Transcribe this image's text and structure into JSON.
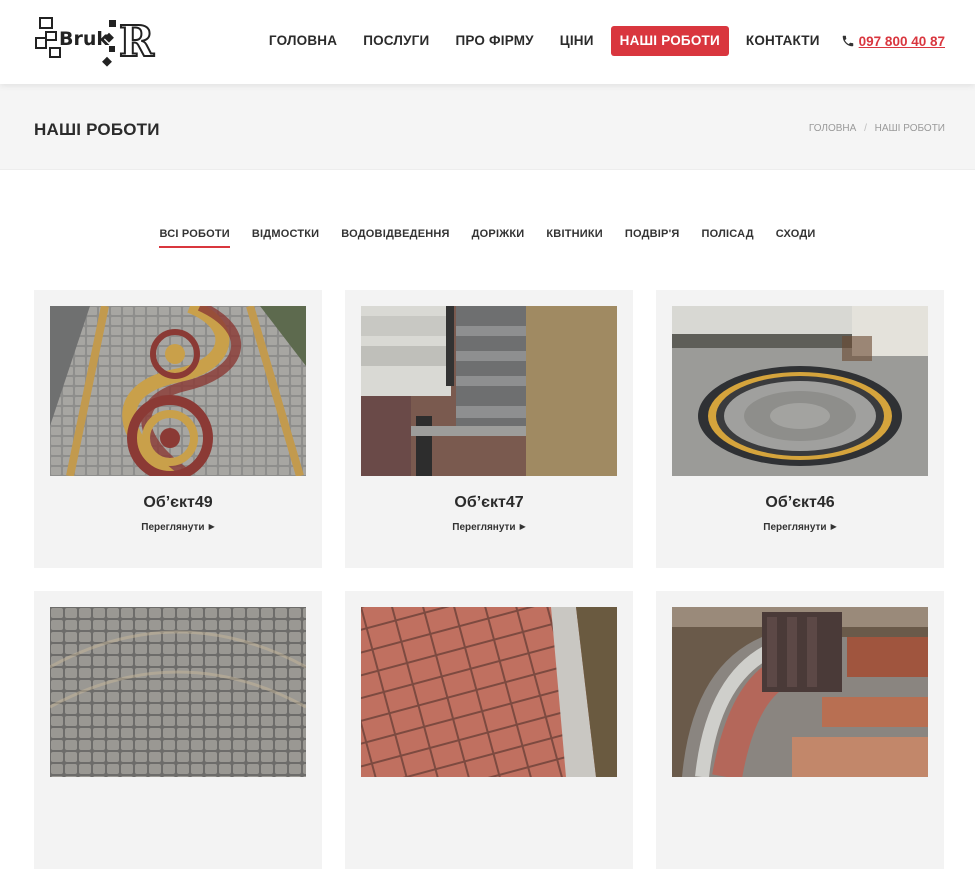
{
  "header": {
    "logo_text": "BrukR",
    "nav": [
      {
        "label": "ГОЛОВНА",
        "active": false
      },
      {
        "label": "ПОСЛУГИ",
        "active": false
      },
      {
        "label": "ПРО ФІРМУ",
        "active": false
      },
      {
        "label": "ЦІНИ",
        "active": false
      },
      {
        "label": "НАШІ РОБОТИ",
        "active": true
      },
      {
        "label": "КОНТАКТИ",
        "active": false
      }
    ],
    "phone": "097 800 40 87",
    "phone_icon": "phone-icon"
  },
  "title_bar": {
    "title": "НАШІ РОБОТИ",
    "breadcrumb": [
      "ГОЛОВНА",
      "НАШІ РОБОТИ"
    ]
  },
  "filters": [
    "ВСІ РОБОТИ",
    "ВІДМОСТКИ",
    "ВОДОВІДВЕДЕННЯ",
    "ДОРІЖКИ",
    "КВІТНИКИ",
    "ПОДВІР'Я",
    "ПОЛІСАД",
    "СХОДИ"
  ],
  "active_filter": "ВСІ РОБОТИ",
  "works": [
    {
      "title": "Об’єкт49",
      "link": "Переглянути",
      "image": "paving-wave-pattern"
    },
    {
      "title": "Об’єкт47",
      "link": "Переглянути",
      "image": "paving-steps-drain"
    },
    {
      "title": "Об’єкт46",
      "link": "Переглянути",
      "image": "paving-circle-pattern"
    },
    {
      "title": "",
      "link": "",
      "image": "cobblestone-arcs"
    },
    {
      "title": "",
      "link": "",
      "image": "red-brick-path"
    },
    {
      "title": "",
      "link": "",
      "image": "curved-steps-planter"
    }
  ],
  "colors": {
    "accent": "#d9363e",
    "card_bg": "#f3f3f3",
    "title_bar_bg": "#f5f5f5"
  }
}
